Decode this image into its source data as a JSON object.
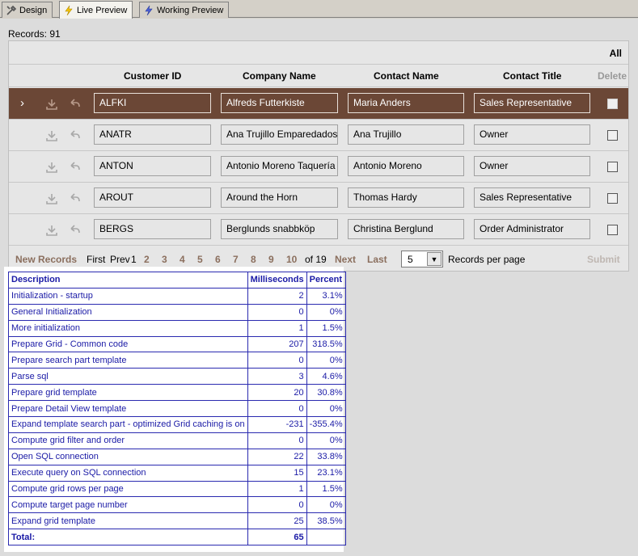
{
  "tabs": [
    {
      "label": "Design",
      "icon": "tools-icon"
    },
    {
      "label": "Live Preview",
      "icon": "lightning-icon",
      "active": true
    },
    {
      "label": "Working Preview",
      "icon": "lightning-blue-icon"
    }
  ],
  "records": {
    "label": "Records:",
    "count": "91"
  },
  "grid": {
    "all_label": "All",
    "headers": {
      "customer_id": "Customer ID",
      "company_name": "Company Name",
      "contact_name": "Contact Name",
      "contact_title": "Contact Title",
      "delete": "Delete"
    },
    "rows": [
      {
        "id": "ALFKI",
        "company": "Alfreds Futterkiste",
        "contact": "Maria Anders",
        "title": "Sales Representative"
      },
      {
        "id": "ANATR",
        "company": "Ana Trujillo Emparedados",
        "contact": "Ana Trujillo",
        "title": "Owner"
      },
      {
        "id": "ANTON",
        "company": "Antonio Moreno Taquería",
        "contact": "Antonio Moreno",
        "title": "Owner"
      },
      {
        "id": "AROUT",
        "company": "Around the Horn",
        "contact": "Thomas Hardy",
        "title": "Sales Representative"
      },
      {
        "id": "BERGS",
        "company": "Berglunds snabbköp",
        "contact": "Christina Berglund",
        "title": "Order Administrator"
      }
    ],
    "selected_index": 0
  },
  "pager": {
    "new_records": "New Records",
    "first": "First",
    "prev": "Prev",
    "current": "1",
    "pages": [
      "2",
      "3",
      "4",
      "5",
      "6",
      "7",
      "8",
      "9",
      "10"
    ],
    "of": "of 19",
    "next": "Next",
    "last": "Last",
    "page_size": "5",
    "per_page_label": "Records per page",
    "submit": "Submit"
  },
  "timing": {
    "headers": [
      "Description",
      "Milliseconds",
      "Percent"
    ],
    "rows": [
      [
        "Initialization - startup",
        "2",
        "3.1%"
      ],
      [
        "General Initialization",
        "0",
        "0%"
      ],
      [
        "More initialization",
        "1",
        "1.5%"
      ],
      [
        "Prepare Grid - Common code",
        "207",
        "318.5%"
      ],
      [
        "Prepare search part template",
        "0",
        "0%"
      ],
      [
        "Parse sql",
        "3",
        "4.6%"
      ],
      [
        "Prepare grid template",
        "20",
        "30.8%"
      ],
      [
        "Prepare Detail View template",
        "0",
        "0%"
      ],
      [
        "Expand template search part - optimized Grid caching is on",
        "-231",
        "-355.4%"
      ],
      [
        "Compute grid filter and order",
        "0",
        "0%"
      ],
      [
        "Open SQL connection",
        "22",
        "33.8%"
      ],
      [
        "Execute query on SQL connection",
        "15",
        "23.1%"
      ],
      [
        "Compute grid rows per page",
        "1",
        "1.5%"
      ],
      [
        "Compute target page number",
        "0",
        "0%"
      ],
      [
        "Expand grid template",
        "25",
        "38.5%"
      ]
    ],
    "total_label": "Total:",
    "total_ms": "65",
    "total_pct": ""
  },
  "colors": {
    "selected_row": "#6b4736",
    "pager_link": "#8b6f5e",
    "timing_text": "#1a1aa6"
  }
}
